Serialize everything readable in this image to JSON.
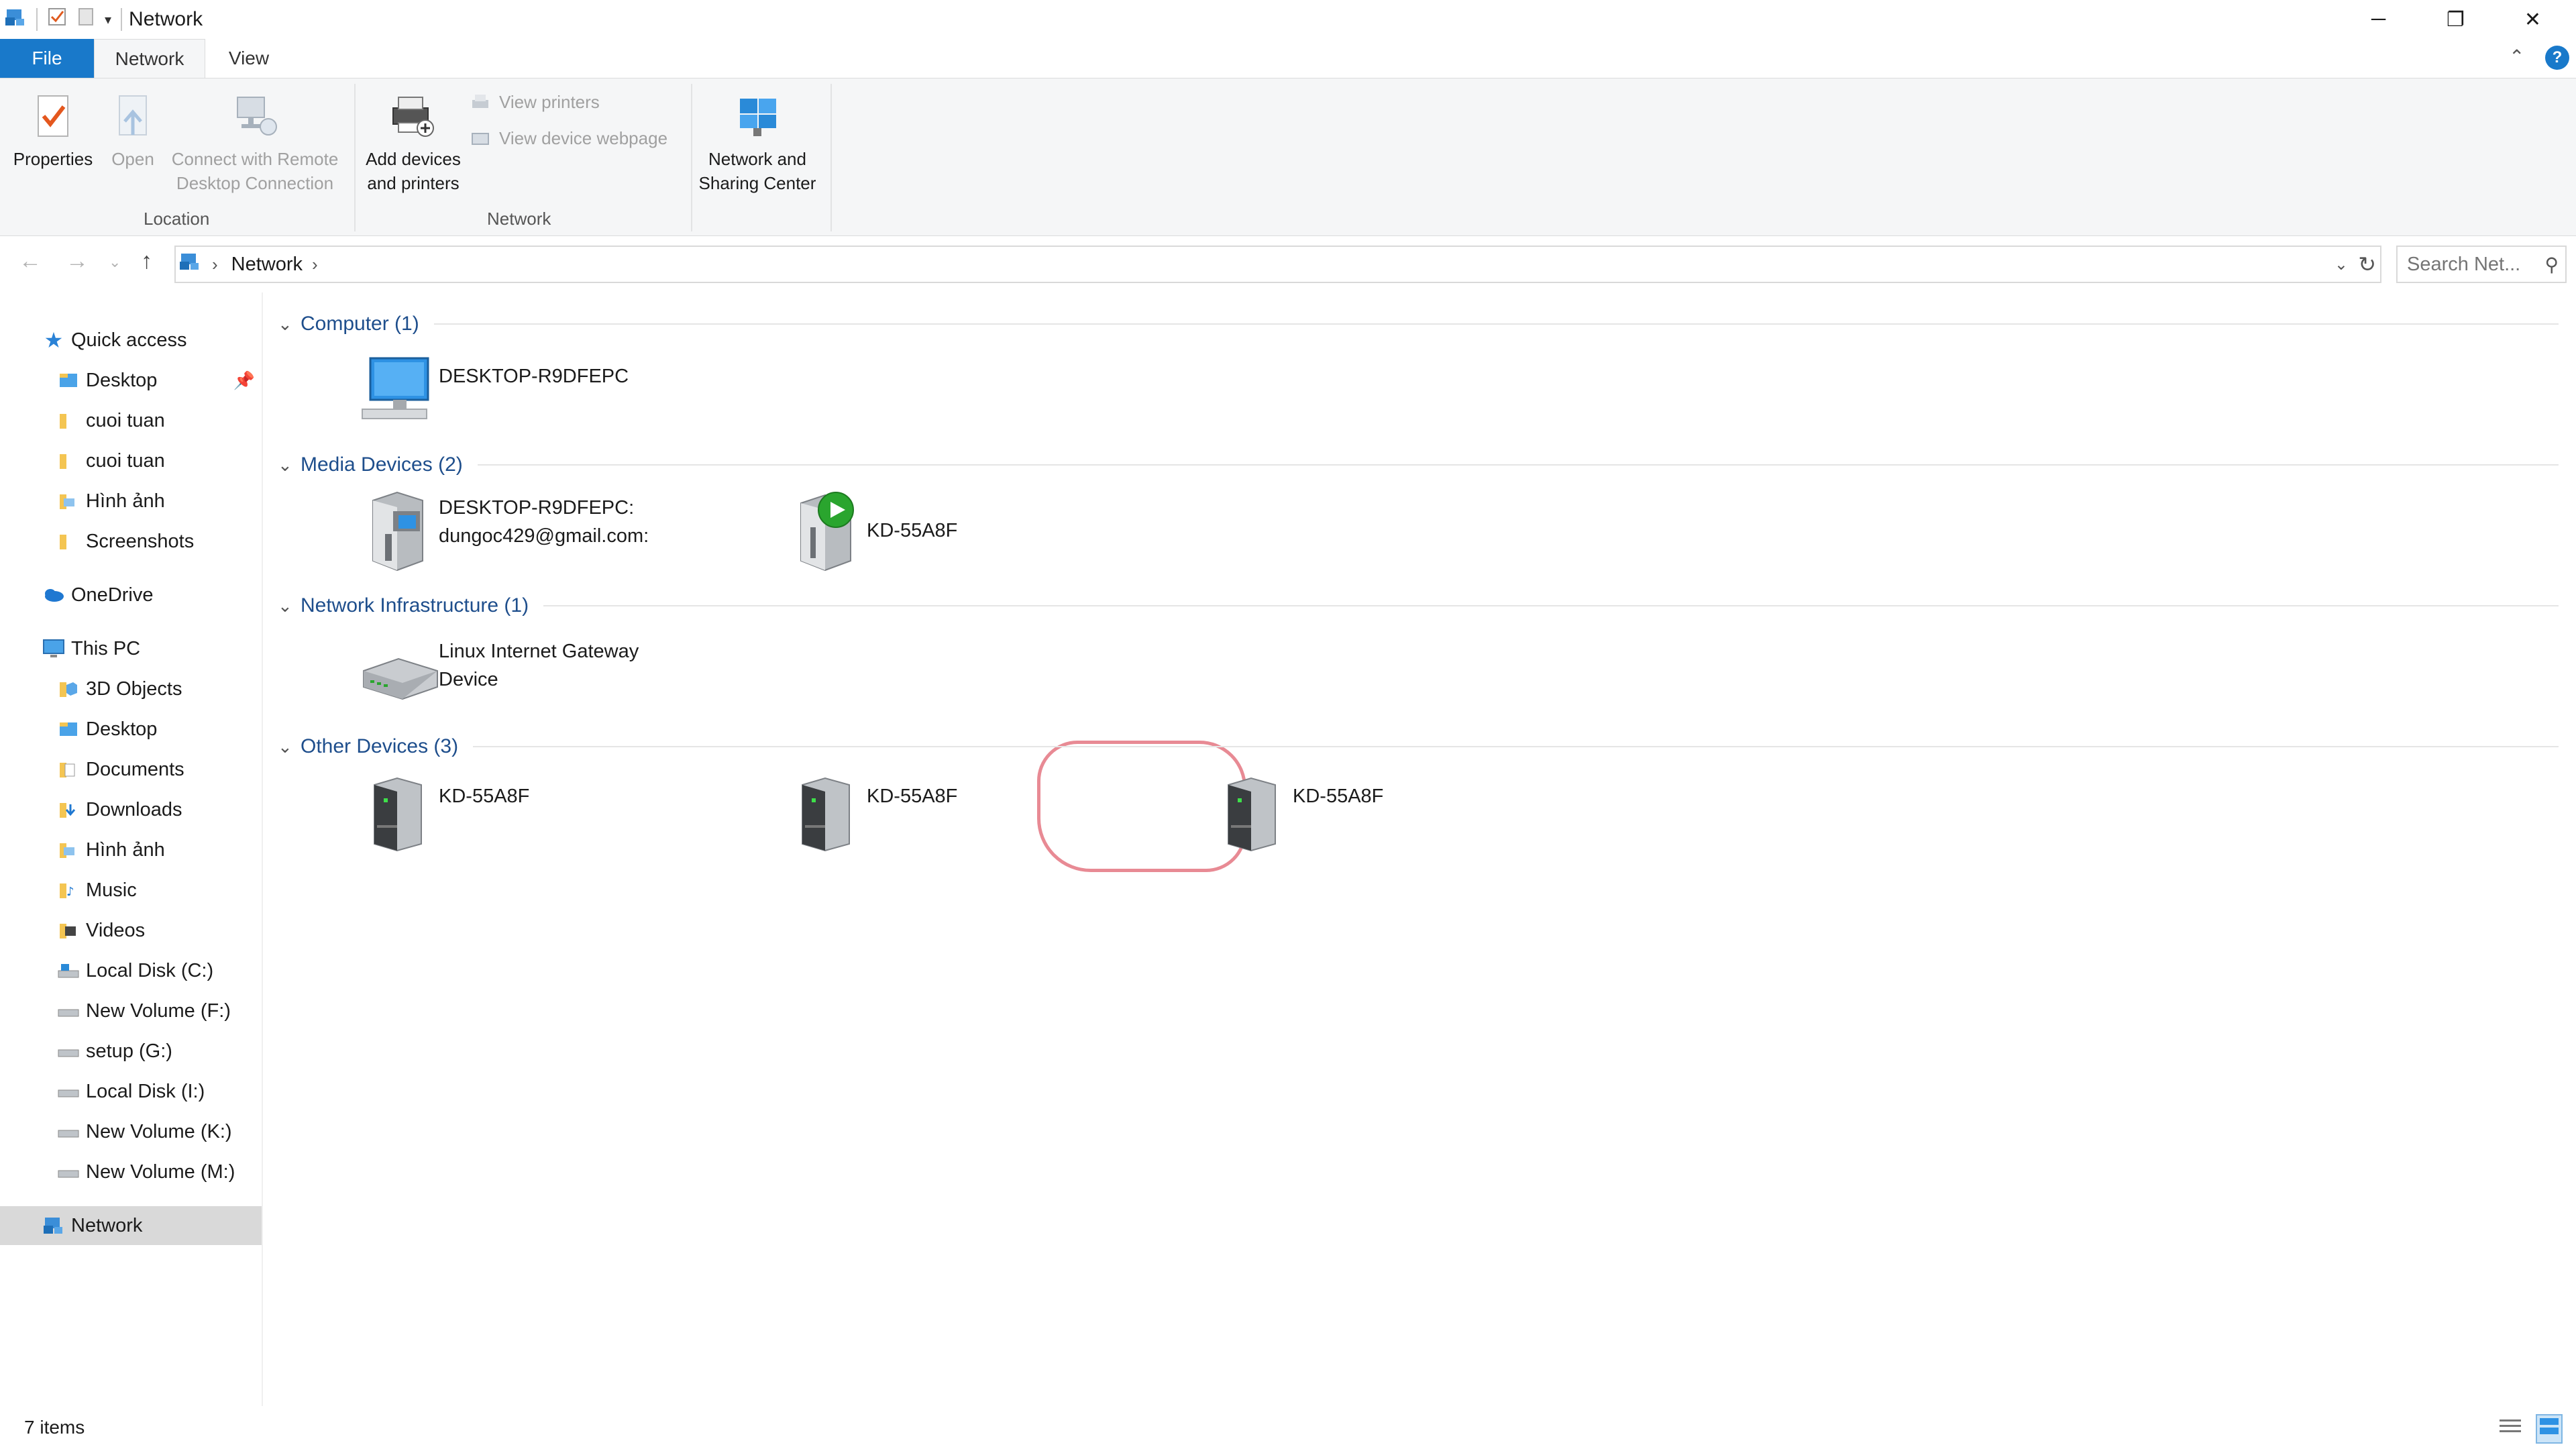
{
  "window": {
    "title": "Network",
    "controls": {
      "minimize": "─",
      "restore": "❐",
      "close": "✕"
    }
  },
  "ribbon": {
    "tabs": {
      "file": "File",
      "network": "Network",
      "view": "View"
    },
    "buttons": {
      "properties": "Properties",
      "open": "Open",
      "connect_rdp_1": "Connect with Remote",
      "connect_rdp_2": "Desktop Connection",
      "add_devices_1": "Add devices",
      "add_devices_2": "and printers",
      "view_printers": "View printers",
      "view_device_webpage": "View device webpage",
      "sharing_center_1": "Network and",
      "sharing_center_2": "Sharing Center"
    },
    "groups": {
      "location": "Location",
      "network": "Network"
    }
  },
  "address_bar": {
    "crumb": "Network",
    "search_placeholder": "Search Net..."
  },
  "sidebar": {
    "quick_access": "Quick access",
    "quick_items": [
      "Desktop",
      "cuoi tuan",
      "cuoi tuan",
      "Hình ảnh",
      "Screenshots"
    ],
    "onedrive": "OneDrive",
    "this_pc": "This PC",
    "pc_items": [
      "3D Objects",
      "Desktop",
      "Documents",
      "Downloads",
      "Hình ảnh",
      "Music",
      "Videos",
      "Local Disk (C:)",
      "New Volume (F:)",
      "setup (G:)",
      "Local Disk (I:)",
      "New Volume (K:)",
      "New Volume (M:)"
    ],
    "network": "Network"
  },
  "groups": {
    "computer": {
      "title": "Computer (1)",
      "items": [
        "DESKTOP-R9DFEPC"
      ]
    },
    "media": {
      "title": "Media Devices (2)",
      "items": [
        {
          "line1": "DESKTOP-R9DFEPC:",
          "line2": "dungoc429@gmail.com:"
        },
        {
          "line1": "KD-55A8F"
        }
      ]
    },
    "infra": {
      "title": "Network Infrastructure (1)",
      "items": [
        {
          "line1": "Linux Internet Gateway",
          "line2": "Device"
        }
      ]
    },
    "other": {
      "title": "Other Devices (3)",
      "items": [
        "KD-55A8F",
        "KD-55A8F",
        "KD-55A8F"
      ]
    }
  },
  "status": {
    "items": "7 items"
  },
  "colors": {
    "accent": "#1979ca",
    "group_title": "#1e4e8c",
    "highlight": "#e88a94",
    "selected": "#d9d9d9"
  }
}
